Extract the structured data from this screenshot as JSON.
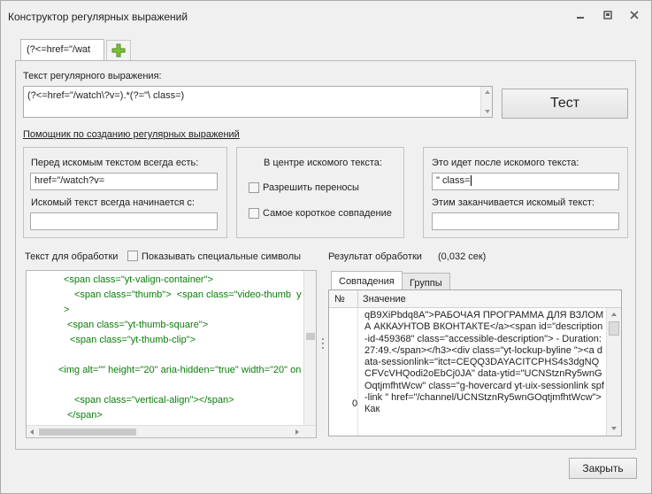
{
  "window": {
    "title": "Конструктор регулярных выражений",
    "controls": {
      "minimize": "▭",
      "restore": "⧉",
      "close": "✕"
    }
  },
  "tabs": {
    "active": "(?<=href=\"/wat",
    "add_icon": "plus-icon"
  },
  "regex": {
    "label": "Текст регулярного выражения:",
    "value": "(?<=href=\"/watch\\?v=).*(?=\"\\ class=)",
    "test_button": "Тест"
  },
  "helper_link": "Помощник по созданию регулярных выражений",
  "before": {
    "label": "Перед искомым текстом всегда есть:",
    "value": "href=\"/watch?v=",
    "starts_label": "Искомый текст всегда начинается с:",
    "starts_value": ""
  },
  "center": {
    "label": "В центре искомого текста:",
    "allow_wrap": "Разрешить переносы",
    "shortest": "Самое короткое совпадение"
  },
  "after": {
    "label": "Это идет после искомого текста:",
    "value": "\" class=",
    "ends_label": "Этим заканчивается искомый текст:",
    "ends_value": ""
  },
  "processing": {
    "label": "Текст для обработки",
    "show_special": "Показывать специальные символы",
    "lines": [
      "<span class=\"yt-valign-container\">",
      "<span class=\"thumb\">  <span class=\"video-thumb  y",
      ">",
      "<span class=\"yt-thumb-square\">",
      "<span class=\"yt-thumb-clip\">",
      "",
      "<img alt=\"\" height=\"20\" aria-hidden=\"true\" width=\"20\" on",
      "",
      "<span class=\"vertical-align\"></span>",
      "</span>"
    ]
  },
  "result": {
    "label": "Результат обработки",
    "time": "(0,032 сек)",
    "tabs": [
      "Совпадения",
      "Группы"
    ],
    "columns": [
      "№",
      "Значение"
    ],
    "row_number": "0",
    "value": "qB9XiPbdq8A\">РАБОЧАЯ ПРОГРАММА ДЛЯ ВЗЛОМА АККАУНТОВ ВКОНТАКТЕ</a><span id=\"description-id-459368\" class=\"accessible-description\"> - Duration: 27:49.</span></h3><div class=\"yt-lockup-byline \"><a data-sessionlink=\"itct=CEQQ3DAYACITCPHS4s3dgNQCFVcVHQodi2oEbCj0JA\" data-ytid=\"UCNStznRy5wnGOqtjmfhtWcw\" class=\"g-hovercard yt-uix-sessionlink spf-link \" href=\"/channel/UCNStznRy5wnGOqtjmfhtWcw\">Как"
  },
  "close_button": "Закрыть"
}
